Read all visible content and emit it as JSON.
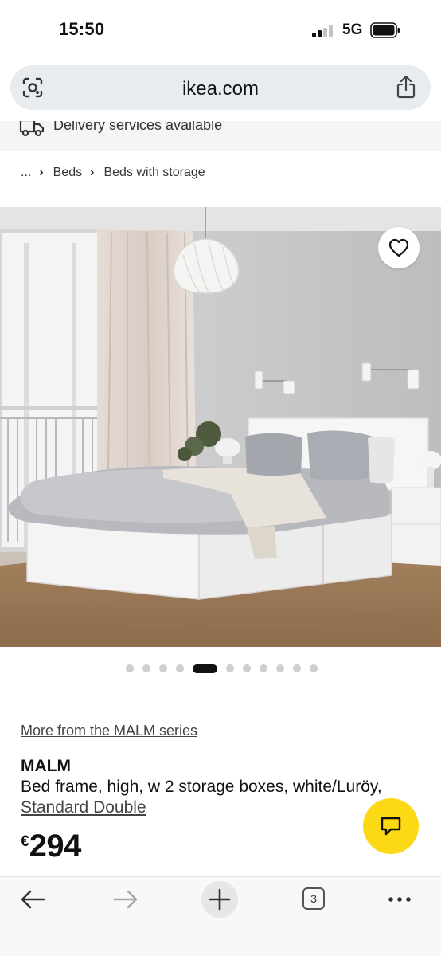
{
  "status_bar": {
    "time": "15:50",
    "network": "5G",
    "icons": [
      "signal-icon",
      "battery-icon"
    ]
  },
  "browser": {
    "url": "ikea.com",
    "left_icon": "page-scan-icon",
    "right_icon": "share-icon"
  },
  "delivery": {
    "icon": "delivery-truck-icon",
    "text": "Delivery services available"
  },
  "breadcrumb": {
    "ellipsis": "...",
    "items": [
      "Beds",
      "Beds with storage"
    ]
  },
  "image": {
    "favourite_icon": "heart-icon",
    "carousel": {
      "total": 11,
      "active": 5
    }
  },
  "product": {
    "series_link": "More from the MALM series",
    "name": "MALM",
    "description": "Bed frame, high, w 2 storage boxes, white/Luröy,",
    "size": "Standard Double",
    "currency": "€",
    "price": "294"
  },
  "chat": {
    "icon": "chat-icon",
    "color": "#FBD914"
  },
  "toolbar": {
    "back_icon": "back-arrow-icon",
    "forward_icon": "forward-arrow-icon",
    "new_tab_icon": "plus-icon",
    "tab_count": "3",
    "more_icon": "more-icon"
  },
  "colors": {
    "url_bar": "#E9ECEF",
    "accent_yellow": "#FBD914",
    "text": "#111111"
  }
}
